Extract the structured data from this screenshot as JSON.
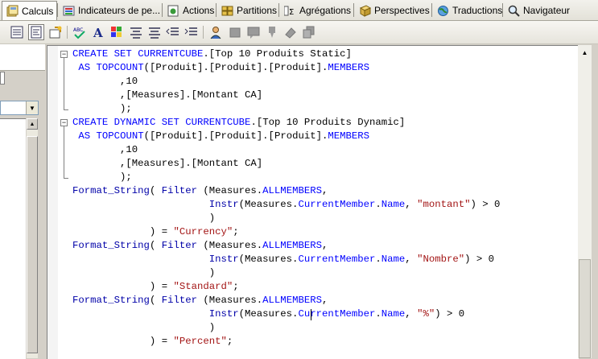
{
  "tabs": [
    {
      "label": "Calculs",
      "icon": "calculator-icon",
      "active": true
    },
    {
      "label": "Indicateurs de pe...",
      "icon": "kpi-icon"
    },
    {
      "label": "Actions",
      "icon": "actions-icon"
    },
    {
      "label": "Partitions",
      "icon": "partitions-icon"
    },
    {
      "label": "Agrégations",
      "icon": "aggregations-icon"
    },
    {
      "label": "Perspectives",
      "icon": "perspectives-icon"
    },
    {
      "label": "Traductions",
      "icon": "translations-icon"
    },
    {
      "label": "Navigateur",
      "icon": "browser-icon"
    }
  ],
  "toolbar": {
    "buttons": [
      "form-view-icon",
      "script-view-icon",
      "new-calculated-member-icon",
      "spell-check-icon",
      "font-icon",
      "color-icon",
      "align-left-icon",
      "align-center-icon",
      "outdent-icon",
      "indent-icon",
      "user-icon",
      "block-icon",
      "comment-icon",
      "marker-icon",
      "eraser-icon",
      "copy-icon"
    ]
  },
  "code": [
    "CREATE SET CURRENTCUBE.[Top 10 Produits Static]",
    " AS TOPCOUNT([Produit].[Produit].[Produit].MEMBERS",
    "        ,10",
    "        ,[Measures].[Montant CA]",
    "        );",
    "CREATE DYNAMIC SET CURRENTCUBE.[Top 10 Produits Dynamic]",
    " AS TOPCOUNT([Produit].[Produit].[Produit].MEMBERS",
    "        ,10",
    "        ,[Measures].[Montant CA]",
    "        );",
    "Format_String( Filter (Measures.ALLMEMBERS,",
    "                       Instr(Measures.CurrentMember.Name, \"montant\") > 0",
    "                       )",
    "             ) = \"Currency\";",
    "Format_String( Filter (Measures.ALLMEMBERS,",
    "                       Instr(Measures.CurrentMember.Name, \"Nombre\") > 0",
    "                       )",
    "             ) = \"Standard\";",
    "Format_String( Filter (Measures.ALLMEMBERS,",
    "                       Instr(Measures.CurrentMember.Name, \"%\") > 0",
    "                       )",
    "             ) = \"Percent\";"
  ],
  "colors": {
    "keyword": "#0000ff",
    "function": "#0000a8",
    "string": "#a31515",
    "text": "#000000"
  }
}
